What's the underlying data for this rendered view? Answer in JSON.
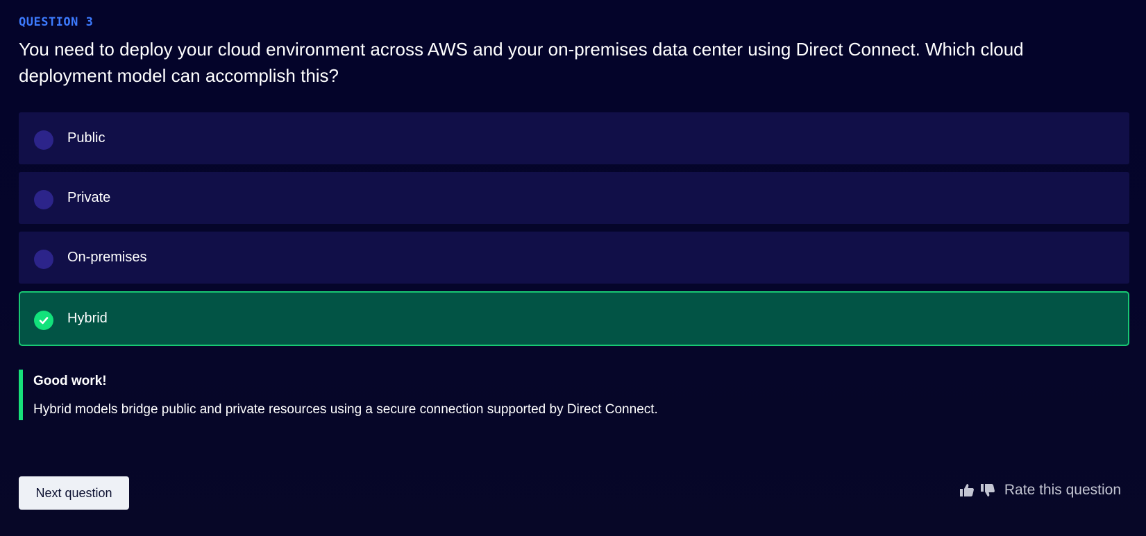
{
  "question": {
    "label": "QUESTION 3",
    "text": "You need to deploy your cloud environment across AWS and your on-premises data center using Direct Connect. Which cloud deployment model can accomplish this?"
  },
  "options": [
    {
      "label": "Public",
      "state": "unselected"
    },
    {
      "label": "Private",
      "state": "unselected"
    },
    {
      "label": "On-premises",
      "state": "unselected"
    },
    {
      "label": "Hybrid",
      "state": "correct"
    }
  ],
  "feedback": {
    "title": "Good work!",
    "body": "Hybrid models bridge public and private resources using a secure connection supported by Direct Connect."
  },
  "actions": {
    "next_label": "Next question",
    "rate_label": "Rate this question"
  },
  "icons": {
    "check": "check-icon",
    "thumbs_up": "thumbs-up-icon",
    "thumbs_down": "thumbs-down-icon"
  },
  "colors": {
    "accent": "#3d7bff",
    "correct_fill": "#025445",
    "correct_border": "#18c873",
    "option_fill": "#110f48"
  }
}
